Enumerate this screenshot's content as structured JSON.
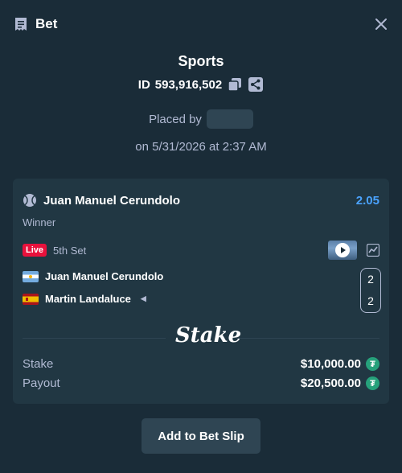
{
  "header": {
    "title": "Bet",
    "icon": "receipt-icon",
    "close_icon": "close-icon"
  },
  "summary": {
    "sport": "Sports",
    "id_label": "ID",
    "id_value": "593,916,502",
    "placed_by_label": "Placed by",
    "placed_by_user": "",
    "date": "on 5/31/2026 at 2:37 AM"
  },
  "bet": {
    "selection": "Juan Manuel Cerundolo",
    "odds": "2.05",
    "market": "Winner",
    "live_label": "Live",
    "set_label": "5th Set",
    "players": [
      {
        "name": "Juan Manuel Cerundolo",
        "flag": "argentina",
        "score": "2",
        "serving": false
      },
      {
        "name": "Martin Landaluce",
        "flag": "spain",
        "score": "2",
        "serving": true
      }
    ],
    "serve_indicator": "◀",
    "brand": "Stake",
    "stake_label": "Stake",
    "stake_value": "$10,000.00",
    "payout_label": "Payout",
    "payout_value": "$20,500.00",
    "currency_glyph": "₮"
  },
  "actions": {
    "add_label": "Add to Bet Slip"
  },
  "colors": {
    "background": "#1a2c38",
    "card": "#213743",
    "accent": "#4aa3ff",
    "live": "#e9113c",
    "tether": "#26a17b"
  }
}
